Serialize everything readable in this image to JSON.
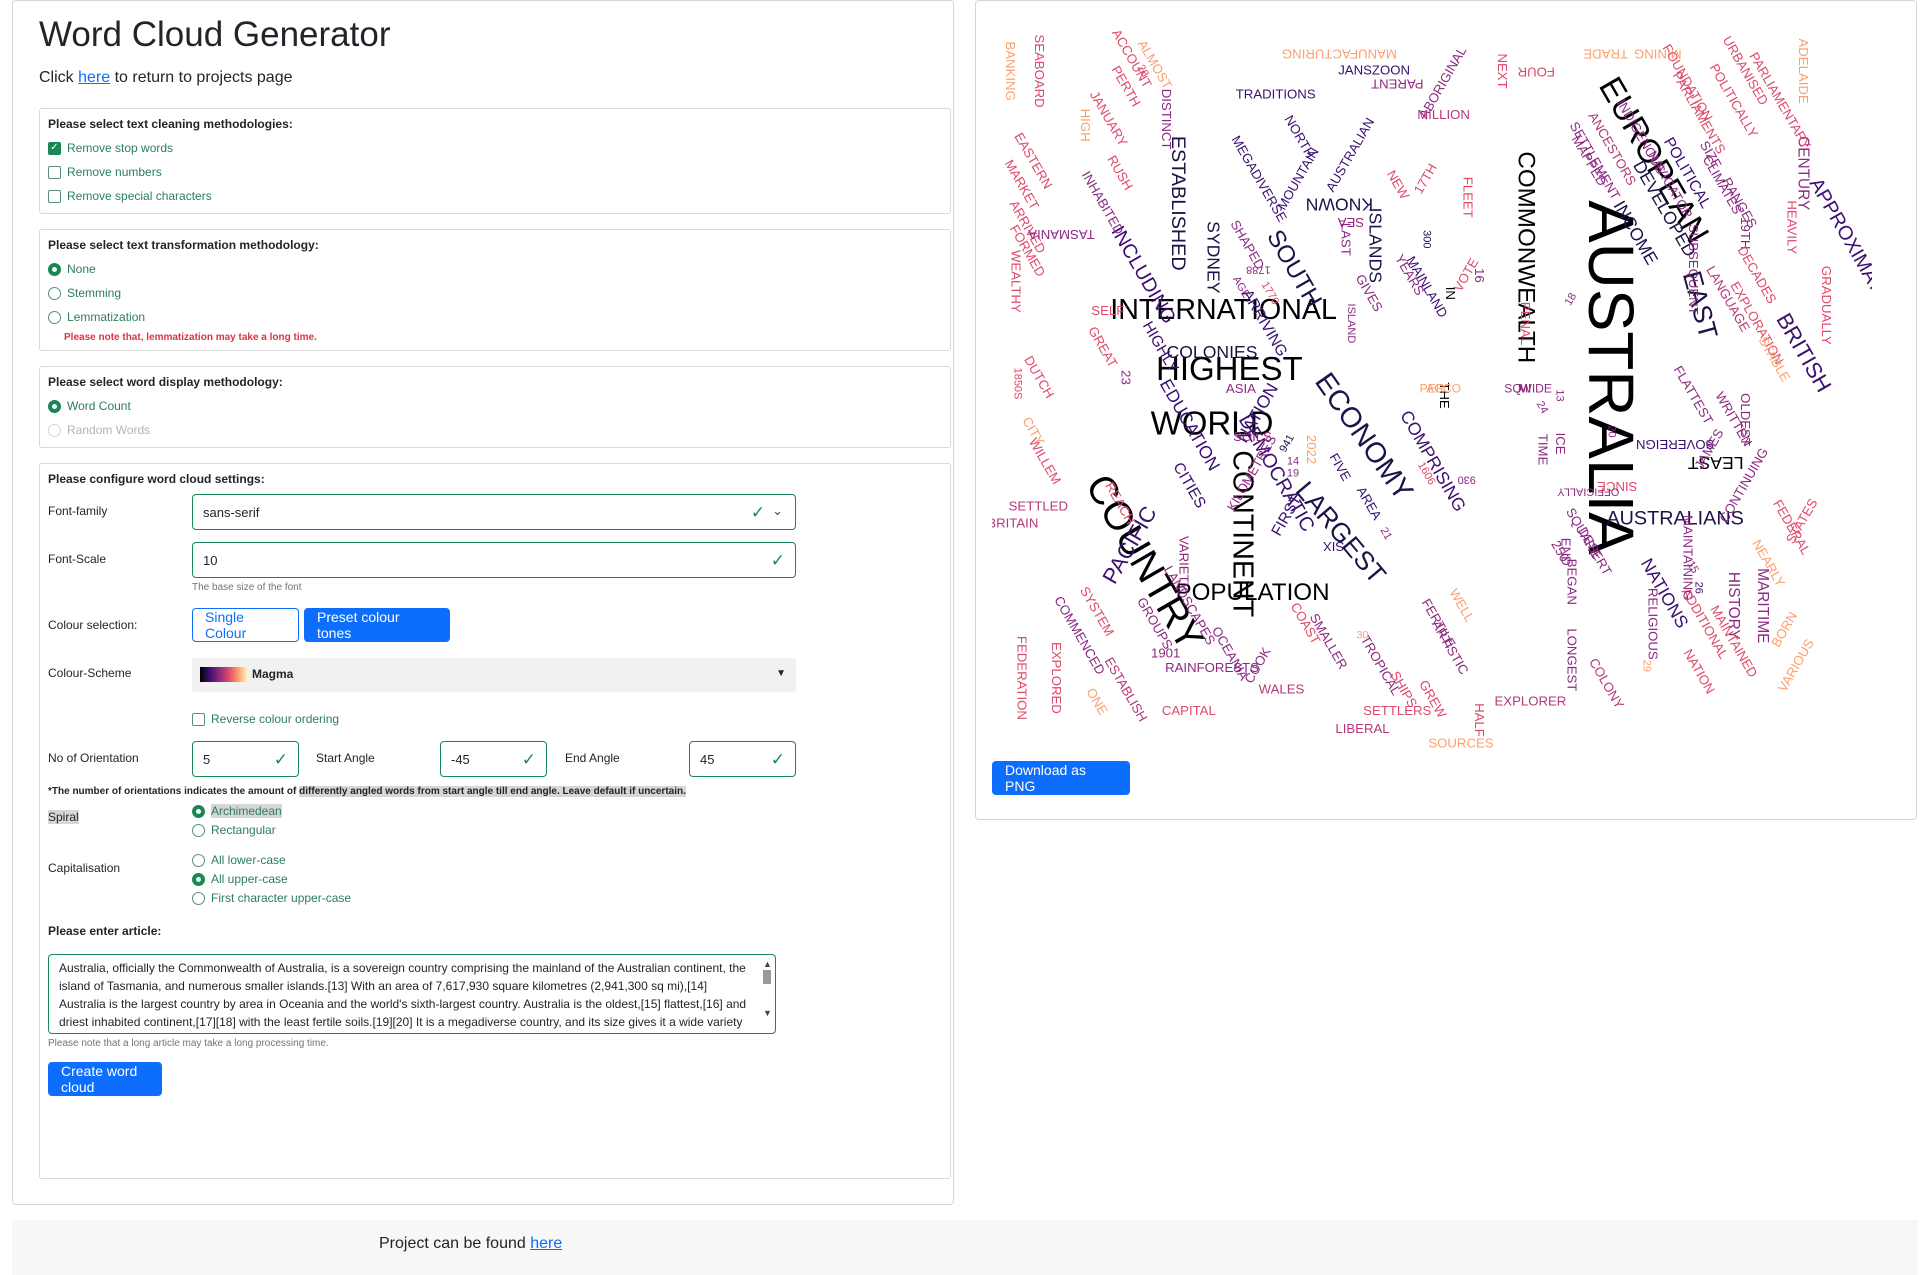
{
  "app": {
    "title": "Word Cloud Generator",
    "return_prefix": "Click",
    "return_link": "here",
    "return_suffix": "to return to projects page"
  },
  "cleaning": {
    "title": "Please select text cleaning methodologies:",
    "options": [
      {
        "label": "Remove stop words",
        "checked": true
      },
      {
        "label": "Remove numbers",
        "checked": false
      },
      {
        "label": "Remove special characters",
        "checked": false
      }
    ]
  },
  "transformation": {
    "title": "Please select text transformation methodology:",
    "options": [
      {
        "label": "None",
        "checked": true
      },
      {
        "label": "Stemming",
        "checked": false
      },
      {
        "label": "Lemmatization",
        "checked": false
      }
    ],
    "note": "Please note that, lemmatization may take a long time."
  },
  "display": {
    "title": "Please select word display methodology:",
    "options": [
      {
        "label": "Word Count",
        "checked": true
      },
      {
        "label": "Random Words",
        "checked": false
      }
    ]
  },
  "settings": {
    "title": "Please configure word cloud settings:",
    "font_family_label": "Font-family",
    "font_family_value": "sans-serif",
    "font_scale_label": "Font-Scale",
    "font_scale_value": "10",
    "font_scale_help": "The base size of the font",
    "colour_selection_label": "Colour selection:",
    "single_colour_label": "Single Colour",
    "preset_tones_label": "Preset colour tones",
    "colour_scheme_label": "Colour-Scheme",
    "colour_scheme_value": "Magma",
    "reverse_label": "Reverse colour ordering",
    "orientation_label": "No of Orientation",
    "orientation_value": "5",
    "start_angle_label": "Start Angle",
    "start_angle_value": "-45",
    "end_angle_label": "End Angle",
    "end_angle_value": "45",
    "orientation_hint_a": "*The number of orientations indicates the amount of ",
    "orientation_hint_b": "differently angled words from start angle till end angle. Leave default if uncertain.",
    "spiral_label": "Spiral",
    "spiral_options": [
      "Archimedean",
      "Rectangular"
    ],
    "capitalisation_label": "Capitalisation",
    "capitalisation_options": [
      "All lower-case",
      "All upper-case",
      "First character upper-case"
    ],
    "article_label": "Please enter article:",
    "article_text": "Australia, officially the Commonwealth of Australia, is a sovereign country comprising the mainland of the Australian continent, the island of Tasmania, and numerous smaller islands.[13] With an area of 7,617,930 square kilometres (2,941,300 sq mi),[14] Australia is the largest country by area in Oceania and the world's sixth-largest country. Australia is the oldest,[15] flattest,[16] and driest inhabited continent,[17][18] with the least fertile soils.[19][20] It is a megadiverse country, and its size gives it a wide variety of landscapes and climates, with deserts in the centre, tropical rainforests in the north-east and mountain ranges in the south-east.",
    "article_help": "Please note that a long article may take a long processing time.",
    "create_label": "Create word cloud"
  },
  "download_label": "Download as PNG",
  "footer": {
    "prefix": "Project can be found",
    "link": "here"
  },
  "colors": {
    "accent": "#0d6efd",
    "success": "#198754",
    "danger": "#dc3545"
  },
  "word_cloud": {
    "words": [
      {
        "t": "AUSTRALIA",
        "c": "#000004"
      },
      {
        "t": "COUNTRY",
        "c": "#000004"
      },
      {
        "t": "WORLD",
        "c": "#000004"
      },
      {
        "t": "CONTINENT",
        "c": "#000004"
      },
      {
        "t": "EUROPEAN",
        "c": "#000004"
      },
      {
        "t": "ECONOMY",
        "c": "#1d1147"
      },
      {
        "t": "HIGHEST",
        "c": "#000004"
      },
      {
        "t": "INTERNATIONAL",
        "c": "#000004"
      },
      {
        "t": "COMMONWEALTH",
        "c": "#000004"
      },
      {
        "t": "LARGEST",
        "c": "#1d1147"
      },
      {
        "t": "POPULATION",
        "c": "#000004"
      },
      {
        "t": "SOUTH",
        "c": "#1d1147"
      },
      {
        "t": "EAST",
        "c": "#1d1147"
      },
      {
        "t": "BRITISH",
        "c": "#3b0f70"
      },
      {
        "t": "APPROXIMATELY",
        "c": "#3b0f70"
      },
      {
        "t": "DEMOCRATIC",
        "c": "#3b0f70"
      },
      {
        "t": "PACIFIC",
        "c": "#3b0f70"
      },
      {
        "t": "ESTABLISHED",
        "c": "#1d1147"
      },
      {
        "t": "INCLUDING",
        "c": "#3b0f70"
      },
      {
        "t": "NATION",
        "c": "#3b0f70"
      },
      {
        "t": "EDUCATION",
        "c": "#3b0f70"
      },
      {
        "t": "AUSTRALIANS",
        "c": "#1d1147"
      },
      {
        "t": "DEVELOPED",
        "c": "#1d1147"
      },
      {
        "t": "INCOME",
        "c": "#1d1147"
      },
      {
        "t": "ISLANDS",
        "c": "#1d1147"
      },
      {
        "t": "SYDNEY",
        "c": "#1d1147"
      },
      {
        "t": "KNOWN",
        "c": "#1d1147"
      },
      {
        "t": "NATIONS",
        "c": "#3b0f70"
      },
      {
        "t": "LEAST",
        "c": "#000004"
      },
      {
        "t": "COLONIES",
        "c": "#1d1147"
      },
      {
        "t": "CITIES",
        "c": "#3b0f70"
      },
      {
        "t": "COMPRISING",
        "c": "#3b0f70"
      },
      {
        "t": "ARRIVING",
        "c": "#3b0f70"
      },
      {
        "t": "FIRST",
        "c": "#3b0f70"
      },
      {
        "t": "CENTURY",
        "c": "#8c2981"
      },
      {
        "t": "HISTORY",
        "c": "#8c2981"
      },
      {
        "t": "MARITIME",
        "c": "#8c2981"
      },
      {
        "t": "POLITICAL",
        "c": "#3b0f70"
      },
      {
        "t": "HIGHLY",
        "c": "#3b0f70"
      },
      {
        "t": "SETTLEMENT",
        "c": "#8c2981"
      },
      {
        "t": "INDIGENOUS",
        "c": "#8c2981"
      },
      {
        "t": "BRITAIN",
        "c": "#b73779"
      },
      {
        "t": "SETTLED",
        "c": "#b73779"
      },
      {
        "t": "RAINFORESTS",
        "c": "#8c2981"
      },
      {
        "t": "CAPITAL",
        "c": "#de4968"
      },
      {
        "t": "WALES",
        "c": "#b73779"
      },
      {
        "t": "SETTLERS",
        "c": "#de4968"
      },
      {
        "t": "LIBERAL",
        "c": "#b73779"
      },
      {
        "t": "SOURCES",
        "c": "#fe9f6d"
      },
      {
        "t": "EXPLORER",
        "c": "#b73779"
      },
      {
        "t": "LONGEST",
        "c": "#8c2981"
      },
      {
        "t": "COLONY",
        "c": "#b73779"
      },
      {
        "t": "RELIGIOUS",
        "c": "#8c2981"
      },
      {
        "t": "FEDERATION",
        "c": "#de4968"
      },
      {
        "t": "EXPLORED",
        "c": "#de4968"
      },
      {
        "t": "ESTABLISH",
        "c": "#b73779"
      },
      {
        "t": "ONE",
        "c": "#fe9f6d"
      },
      {
        "t": "WEALTHY",
        "c": "#de4968"
      },
      {
        "t": "1850S",
        "c": "#de4968"
      },
      {
        "t": "FORMED",
        "c": "#de4968"
      },
      {
        "t": "ARRIVED",
        "c": "#de4968"
      },
      {
        "t": "MARKET",
        "c": "#de4968"
      },
      {
        "t": "EASTERN",
        "c": "#de4968"
      },
      {
        "t": "BANKING",
        "c": "#fe9f6d"
      },
      {
        "t": "SEABOARD",
        "c": "#de4968"
      },
      {
        "t": "HIGH",
        "c": "#fe9f6d"
      },
      {
        "t": "JANUARY",
        "c": "#de4968"
      },
      {
        "t": "RUSH",
        "c": "#de4968"
      },
      {
        "t": "PERTH",
        "c": "#de4968"
      },
      {
        "t": "ACCOUNT",
        "c": "#de4968"
      },
      {
        "t": "ALMOST",
        "c": "#fe9f6d"
      },
      {
        "t": "TRADITIONS",
        "c": "#3b0f70"
      },
      {
        "t": "MANUFACTURING",
        "c": "#fe9f6d"
      },
      {
        "t": "JANSZOON",
        "c": "#3b0f70"
      },
      {
        "t": "PARENT",
        "c": "#8c2981"
      },
      {
        "t": "ABORIGINAL",
        "c": "#8c2981"
      },
      {
        "t": "MILLION",
        "c": "#b73779"
      },
      {
        "t": "NEXT",
        "c": "#de4968"
      },
      {
        "t": "FOUR",
        "c": "#de4968"
      },
      {
        "t": "TRADE",
        "c": "#fe9f6d"
      },
      {
        "t": "MINING",
        "c": "#fe9f6d"
      },
      {
        "t": "FOUNDATION",
        "c": "#de4968"
      },
      {
        "t": "PARLIAMENTS",
        "c": "#de4968"
      },
      {
        "t": "URBANISED",
        "c": "#de4968"
      },
      {
        "t": "PARLIAMENTARY",
        "c": "#de4968"
      },
      {
        "t": "ADELAIDE",
        "c": "#fe9f6d"
      },
      {
        "t": "POLITICALLY",
        "c": "#de4968"
      },
      {
        "t": "HEAVILY",
        "c": "#de4968"
      },
      {
        "t": "GRADUALLY",
        "c": "#de4968"
      },
      {
        "t": "NAVIGATOR",
        "c": "#8c2981"
      },
      {
        "t": "19TH",
        "c": "#8c2981"
      },
      {
        "t": "DECADES",
        "c": "#de4968"
      },
      {
        "t": "LANGUAGE",
        "c": "#b73779"
      },
      {
        "t": "EXPLORATION",
        "c": "#de4968"
      },
      {
        "t": "STABLE",
        "c": "#fe9f6d"
      },
      {
        "t": "FLATTEST",
        "c": "#8c2981"
      },
      {
        "t": "SOVEREIGN",
        "c": "#3b0f70"
      },
      {
        "t": "WRITTEN",
        "c": "#8c2981"
      },
      {
        "t": "CONTINUING",
        "c": "#8c2981"
      },
      {
        "t": "STATES",
        "c": "#de4968"
      },
      {
        "t": "FEDERAL",
        "c": "#de4968"
      },
      {
        "t": "NEARLY",
        "c": "#fe9f6d"
      },
      {
        "t": "ADDITIONAL",
        "c": "#de4968"
      },
      {
        "t": "MAINTAINED",
        "c": "#de4968"
      },
      {
        "t": "BORN",
        "c": "#fe9f6d"
      },
      {
        "t": "VARIOUS",
        "c": "#fe9f6d"
      },
      {
        "t": "NATION",
        "c": "#de4968"
      },
      {
        "t": "MAINTAINING",
        "c": "#8c2981"
      },
      {
        "t": "JAMES",
        "c": "#8c2981"
      },
      {
        "t": "SINCE",
        "c": "#de4968"
      },
      {
        "t": "OFFICIALLY",
        "c": "#8c2981"
      },
      {
        "t": "DESERT",
        "c": "#8c2981"
      },
      {
        "t": "SQUARE",
        "c": "#8c2981"
      },
      {
        "t": "BEGAN",
        "c": "#8c2981"
      },
      {
        "t": "END",
        "c": "#8c2981"
      },
      {
        "t": "DUTCH",
        "c": "#de4968"
      },
      {
        "t": "CITY",
        "c": "#fe9f6d"
      },
      {
        "t": "WILLEM",
        "c": "#de4968"
      },
      {
        "t": "GREAT",
        "c": "#de4968"
      },
      {
        "t": "SELF",
        "c": "#de4968"
      },
      {
        "t": "REACH",
        "c": "#de4968"
      },
      {
        "t": "GROUPS",
        "c": "#8c2981"
      },
      {
        "t": "LANDSCAPES",
        "c": "#8c2981"
      },
      {
        "t": "SYSTEM",
        "c": "#de4968"
      },
      {
        "t": "COMMENCED",
        "c": "#8c2981"
      },
      {
        "t": "1901",
        "c": "#8c2981"
      },
      {
        "t": "OCEANIA",
        "c": "#8c2981"
      },
      {
        "t": "COOK",
        "c": "#8c2981"
      },
      {
        "t": "COAST",
        "c": "#de4968"
      },
      {
        "t": "SMALLER",
        "c": "#8c2981"
      },
      {
        "t": "TROPICAL",
        "c": "#8c2981"
      },
      {
        "t": "SHIPS",
        "c": "#de4968"
      },
      {
        "t": "GREW",
        "c": "#de4968"
      },
      {
        "t": "ARTISTIC",
        "c": "#8c2981"
      },
      {
        "t": "HALF",
        "c": "#de4968"
      },
      {
        "t": "WELL",
        "c": "#fe9f6d"
      },
      {
        "t": "FERTILE",
        "c": "#8c2981"
      },
      {
        "t": "VARIETY",
        "c": "#8c2981"
      },
      {
        "t": "SOILS",
        "c": "#8c2981"
      },
      {
        "t": "ASIA",
        "c": "#8c2981"
      },
      {
        "t": "KILOMETRES",
        "c": "#8c2981"
      },
      {
        "t": "FIVE",
        "c": "#3b0f70"
      },
      {
        "t": "AREA",
        "c": "#3b0f70"
      },
      {
        "t": "SIX",
        "c": "#3b0f70"
      },
      {
        "t": "TIME",
        "c": "#8c2981"
      },
      {
        "t": "ICE",
        "c": "#8c2981"
      },
      {
        "t": "THE",
        "c": "#000004"
      },
      {
        "t": "IN",
        "c": "#000004"
      },
      {
        "t": "VOTE",
        "c": "#de4968"
      },
      {
        "t": "FLEET",
        "c": "#de4968"
      },
      {
        "t": "MAINLAND",
        "c": "#3b0f70"
      },
      {
        "t": "YEARS",
        "c": "#8c2981"
      },
      {
        "t": "GIVES",
        "c": "#8c2981"
      },
      {
        "t": "SEA",
        "c": "#8c2981"
      },
      {
        "t": "LAST",
        "c": "#8c2981"
      },
      {
        "t": "17TH",
        "c": "#de4968"
      },
      {
        "t": "NEW",
        "c": "#de4968"
      },
      {
        "t": "AUSTRALIAN",
        "c": "#3b0f70"
      },
      {
        "t": "MOUNTAIN",
        "c": "#3b0f70"
      },
      {
        "t": "NORTH",
        "c": "#3b0f70"
      },
      {
        "t": "MEGADIVERSE",
        "c": "#3b0f70"
      },
      {
        "t": "SHAPED",
        "c": "#8c2981"
      },
      {
        "t": "DISTINCT",
        "c": "#8c2981"
      },
      {
        "t": "INHABITED",
        "c": "#8c2981"
      },
      {
        "t": "TASMANIA",
        "c": "#8c2981"
      },
      {
        "t": "MAPPED",
        "c": "#8c2981"
      },
      {
        "t": "ANCESTORS",
        "c": "#b73779"
      },
      {
        "t": "SIZE",
        "c": "#8c2981"
      },
      {
        "t": "CLIMATES",
        "c": "#8c2981"
      },
      {
        "t": "RANGES",
        "c": "#8c2981"
      },
      {
        "t": "SUBSEQUENT",
        "c": "#8c2981"
      },
      {
        "t": "OLDEST",
        "c": "#8c2981"
      },
      {
        "t": "PENAL",
        "c": "#de4968"
      },
      {
        "t": "1788",
        "c": "#8c2981"
      },
      {
        "t": "AGE",
        "c": "#8c2981"
      },
      {
        "t": "1770",
        "c": "#de4968"
      },
      {
        "t": "ISLAND",
        "c": "#8c2981"
      },
      {
        "t": "300",
        "c": "#1d1147"
      },
      {
        "t": "18",
        "c": "#8c2981"
      },
      {
        "t": "16",
        "c": "#8c2981"
      },
      {
        "t": "930",
        "c": "#8c2981"
      },
      {
        "t": "24",
        "c": "#8c2981"
      },
      {
        "t": "13",
        "c": "#8c2981"
      },
      {
        "t": "26",
        "c": "#3b0f70"
      },
      {
        "t": "20",
        "c": "#8c2981"
      },
      {
        "t": "1606",
        "c": "#de4968"
      },
      {
        "t": "941",
        "c": "#1d1147"
      },
      {
        "t": "14",
        "c": "#8c2981"
      },
      {
        "t": "19",
        "c": "#8c2981"
      },
      {
        "t": "2022",
        "c": "#fe9f6d"
      },
      {
        "t": "23",
        "c": "#8c2981"
      },
      {
        "t": "250",
        "c": "#8c2981"
      },
      {
        "t": "21",
        "c": "#8c2981"
      },
      {
        "t": "15",
        "c": "#8c2981"
      },
      {
        "t": "30",
        "c": "#fe9f6d"
      },
      {
        "t": "29",
        "c": "#fe9f6d"
      },
      {
        "t": "28",
        "c": "#de4968"
      },
      {
        "t": "SQ",
        "c": "#8c2981"
      },
      {
        "t": "MI",
        "c": "#8c2981"
      },
      {
        "t": "WIDE",
        "c": "#8c2981"
      },
      {
        "t": "PER",
        "c": "#fe9f6d"
      },
      {
        "t": "ACCO",
        "c": "#fe9f6d"
      }
    ]
  }
}
